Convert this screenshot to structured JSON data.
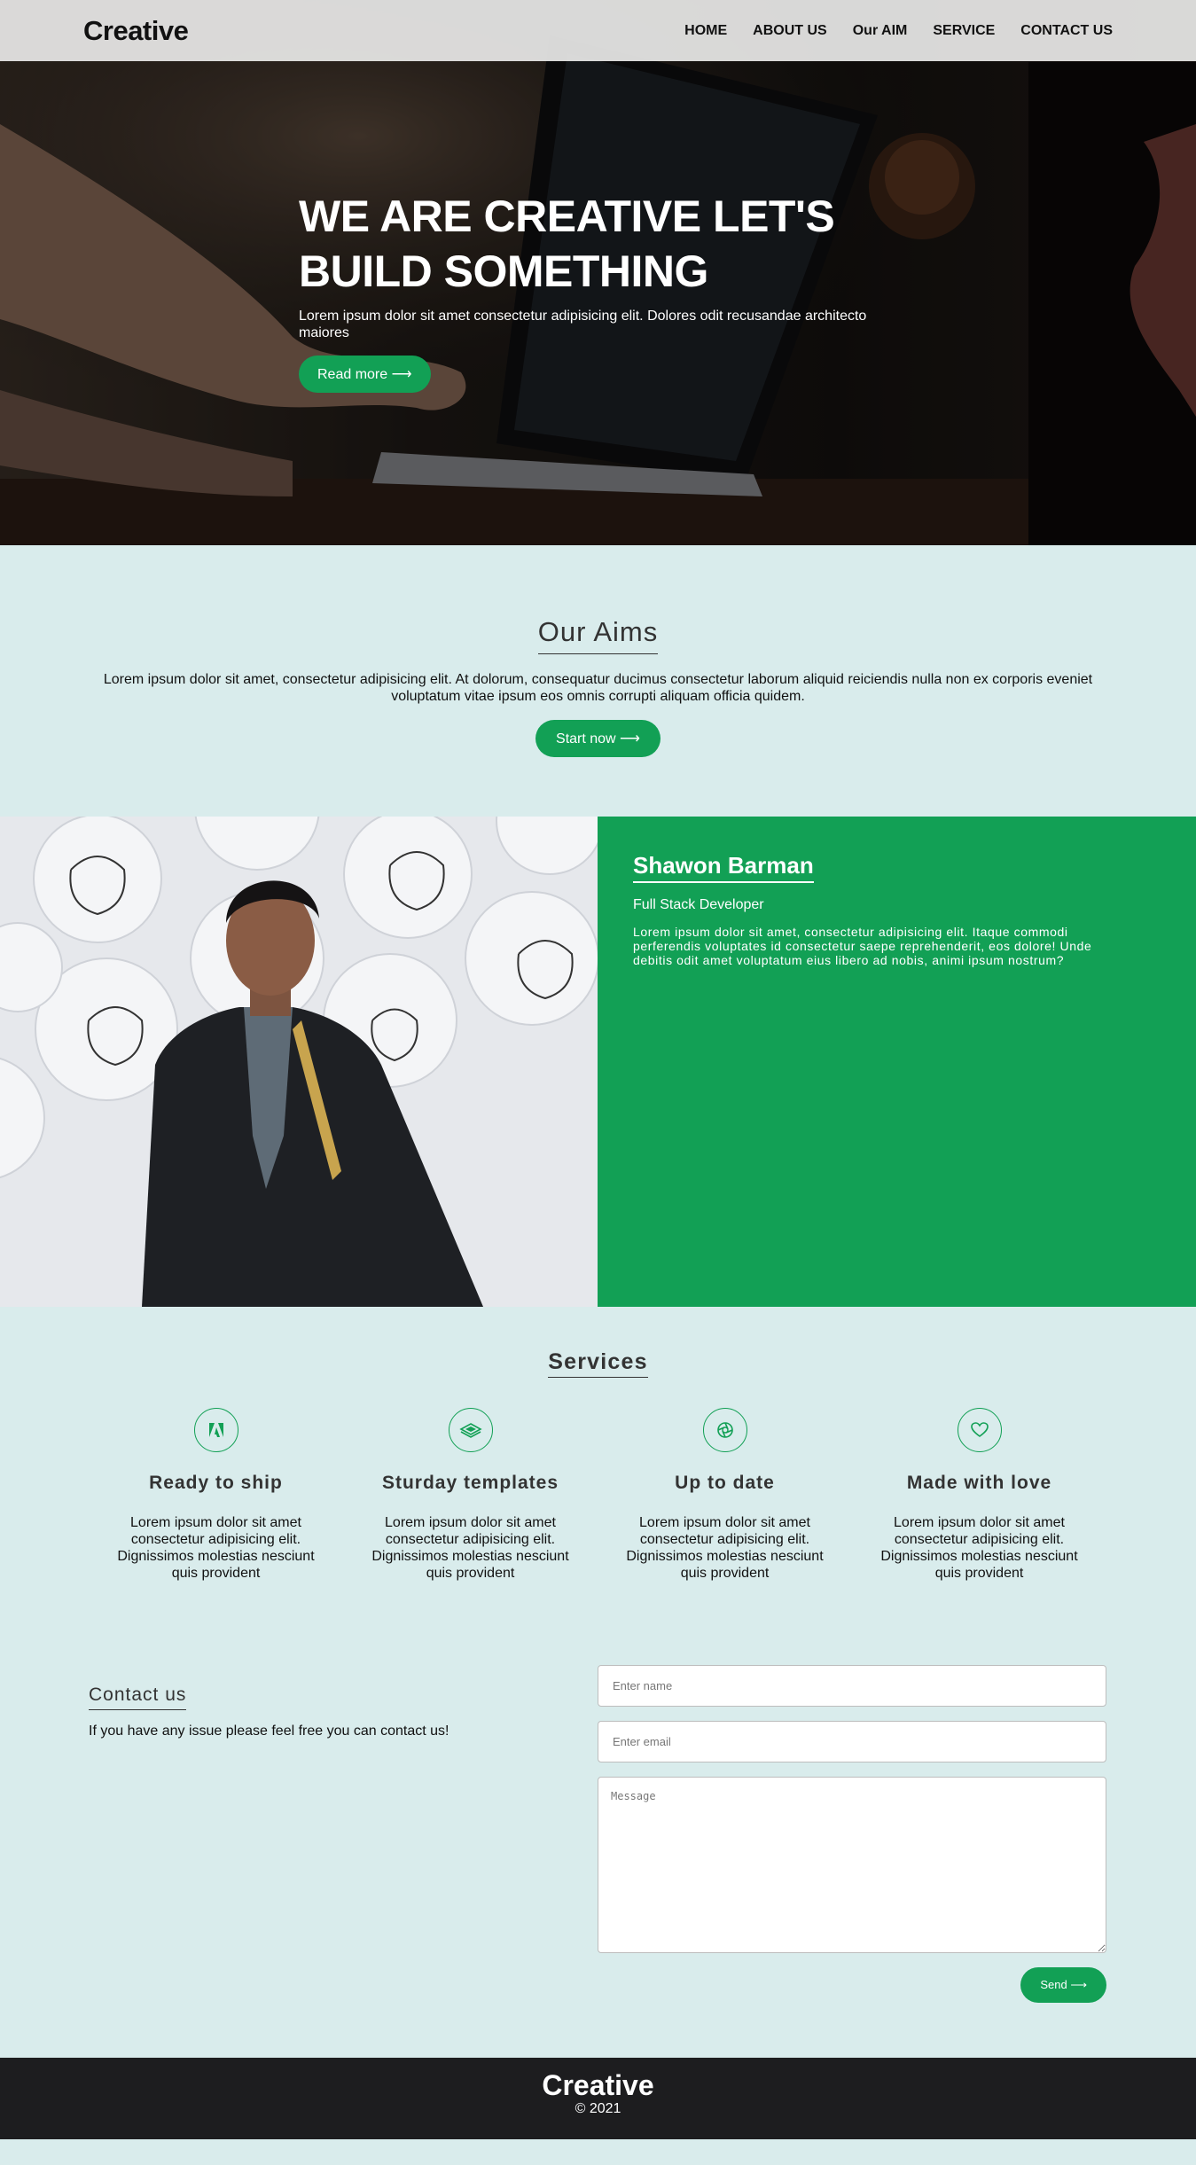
{
  "nav": {
    "brand": "Creative",
    "links": [
      "HOME",
      "ABOUT US",
      "Our AIM",
      "SERVICE",
      "CONTACT US"
    ]
  },
  "hero": {
    "title": "WE ARE CREATIVE LET'S BUILD SOMETHING",
    "text": "Lorem ipsum dolor sit amet consectetur adipisicing elit. Dolores odit recusandae architecto maiores",
    "button": "Read more ⟶"
  },
  "aims": {
    "title": "Our Aims",
    "text": "Lorem ipsum dolor sit amet, consectetur adipisicing elit. At dolorum, consequatur ducimus consectetur laborum aliquid reiciendis nulla non ex corporis eveniet voluptatum vitae ipsum eos omnis corrupti aliquam officia quidem.",
    "button": "Start now ⟶"
  },
  "profile": {
    "name": "Shawon Barman",
    "role": "Full Stack Developer",
    "bio": "Lorem ipsum dolor sit amet, consectetur adipisicing elit. Itaque commodi perferendis voluptates id consectetur saepe reprehenderit, eos dolore! Unde debitis odit amet voluptatum eius libero ad nobis, animi ipsum nostrum?"
  },
  "services": {
    "title": "Services",
    "items": [
      {
        "icon": "adobe-icon",
        "title": "Ready to ship",
        "text": "Lorem ipsum dolor sit amet consectetur adipisicing elit. Dignissimos molestias nesciunt quis provident"
      },
      {
        "icon": "layers-icon",
        "title": "Sturday templates",
        "text": "Lorem ipsum dolor sit amet consectetur adipisicing elit. Dignissimos molestias nesciunt quis provident"
      },
      {
        "icon": "aperture-icon",
        "title": "Up to date",
        "text": "Lorem ipsum dolor sit amet consectetur adipisicing elit. Dignissimos molestias nesciunt quis provident"
      },
      {
        "icon": "heart-icon",
        "title": "Made with love",
        "text": "Lorem ipsum dolor sit amet consectetur adipisicing elit. Dignissimos molestias nesciunt quis provident"
      }
    ]
  },
  "contact": {
    "title": "Contact us",
    "text": "If you have any issue please feel free you can contact us!",
    "name_placeholder": "Enter name",
    "email_placeholder": "Enter email",
    "message_placeholder": "Message",
    "send": "Send ⟶"
  },
  "footer": {
    "brand": "Creative",
    "copy": "© 2021"
  },
  "colors": {
    "accent": "#12a055",
    "page_bg": "#d9ecec",
    "footer_bg": "#1d1d1f"
  }
}
